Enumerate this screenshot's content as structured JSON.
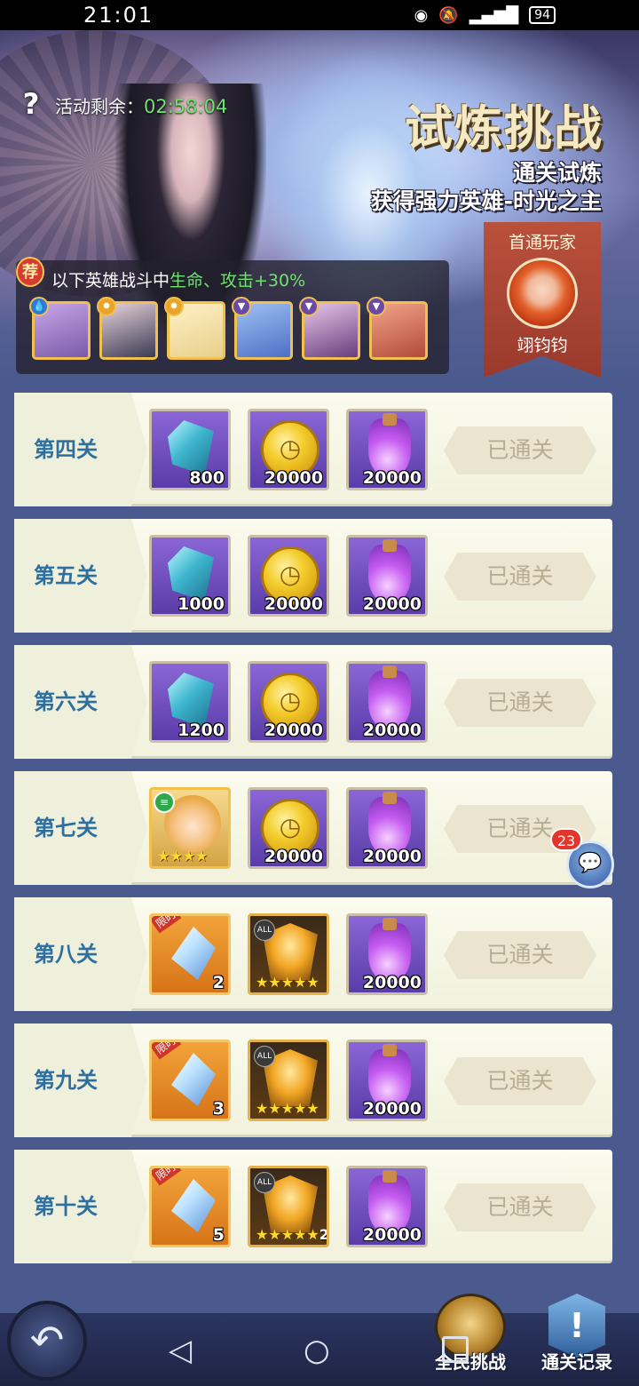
{
  "status_bar": {
    "time": "21:01",
    "battery": "94"
  },
  "banner": {
    "timer_label": "活动剩余：",
    "timer_value": "02:58:04",
    "title": "试炼挑战",
    "subtitle_line1": "通关试炼",
    "subtitle_line2": "获得强力英雄-时光之主",
    "first_clear": {
      "title": "首通玩家",
      "player_name": "翊钧钧"
    },
    "recommend": {
      "badge": "荐",
      "text_prefix": "以下英雄战斗中",
      "text_highlight": "生命、攻击+30%",
      "heroes": [
        {
          "name": "hero-1",
          "color": "#7a5aa8"
        },
        {
          "name": "hero-2",
          "color": "#3a3a52"
        },
        {
          "name": "hero-3",
          "color": "#e8cf8c"
        },
        {
          "name": "hero-4",
          "color": "#4d6fc6"
        },
        {
          "name": "hero-5",
          "color": "#6a3c7c"
        },
        {
          "name": "hero-6",
          "color": "#b24a3a"
        }
      ]
    }
  },
  "stages": [
    {
      "label": "第四关",
      "status": "已通关",
      "rewards": [
        {
          "type": "crystal",
          "count": "800"
        },
        {
          "type": "coin",
          "count": "20000"
        },
        {
          "type": "potion",
          "count": "20000"
        }
      ]
    },
    {
      "label": "第五关",
      "status": "已通关",
      "rewards": [
        {
          "type": "crystal",
          "count": "1000"
        },
        {
          "type": "coin",
          "count": "20000"
        },
        {
          "type": "potion",
          "count": "20000"
        }
      ]
    },
    {
      "label": "第六关",
      "status": "已通关",
      "rewards": [
        {
          "type": "crystal",
          "count": "1200"
        },
        {
          "type": "coin",
          "count": "20000"
        },
        {
          "type": "potion",
          "count": "20000"
        }
      ]
    },
    {
      "label": "第七关",
      "status": "已通关",
      "rewards": [
        {
          "type": "hero",
          "stars": "★★★★"
        },
        {
          "type": "coin",
          "count": "20000"
        },
        {
          "type": "potion",
          "count": "20000"
        }
      ]
    },
    {
      "label": "第八关",
      "status": "已通关",
      "rewards": [
        {
          "type": "shard",
          "tag": "限时",
          "count": "2"
        },
        {
          "type": "mask",
          "tag": "ALL",
          "stars": "★★★★★"
        },
        {
          "type": "potion",
          "count": "20000"
        }
      ]
    },
    {
      "label": "第九关",
      "status": "已通关",
      "rewards": [
        {
          "type": "shard",
          "tag": "限时",
          "count": "3"
        },
        {
          "type": "mask",
          "tag": "ALL",
          "stars": "★★★★★"
        },
        {
          "type": "potion",
          "count": "20000"
        }
      ]
    },
    {
      "label": "第十关",
      "status": "已通关",
      "rewards": [
        {
          "type": "shard",
          "tag": "限时",
          "count": "5"
        },
        {
          "type": "mask",
          "tag": "ALL",
          "stars": "★★★★★",
          "count": "2"
        },
        {
          "type": "potion",
          "count": "20000"
        }
      ]
    }
  ],
  "chat": {
    "badge_count": "23"
  },
  "bottom": {
    "all_challenge_label": "全民挑战",
    "records_label": "通关记录"
  }
}
